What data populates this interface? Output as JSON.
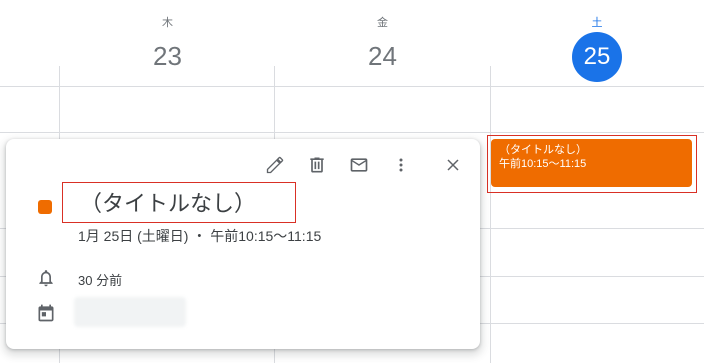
{
  "columns": [
    {
      "dow": "木",
      "date": "23"
    },
    {
      "dow": "金",
      "date": "24"
    },
    {
      "dow": "土",
      "date": "25"
    }
  ],
  "event_chip": {
    "title": "（タイトルなし）",
    "time": "午前10:15～11:15"
  },
  "popup": {
    "toolbar": [
      "edit-icon",
      "delete-icon",
      "email-icon",
      "more-options-icon",
      "close-icon"
    ],
    "title": "（タイトルなし）",
    "when": "1月 25日 (土曜日) ・ 午前10:15～11:15",
    "reminder": "30 分前",
    "color": "#ef6c00"
  },
  "colors": {
    "accent": "#1a73e8",
    "event": "#ef6c00",
    "highlight": "#d93025"
  }
}
